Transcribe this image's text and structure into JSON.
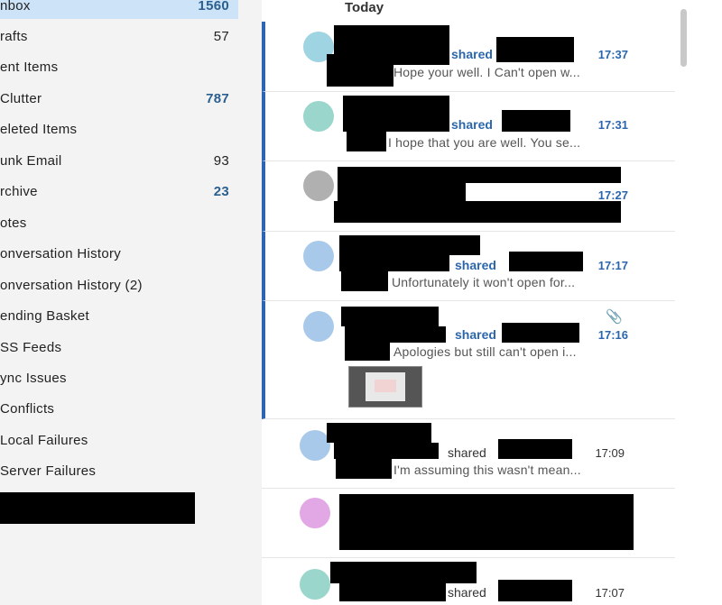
{
  "folders": [
    {
      "label": "nbox",
      "count": "1560",
      "unread": true,
      "selected": true
    },
    {
      "label": "rafts",
      "count": "57",
      "unread": false
    },
    {
      "label": "ent Items",
      "count": "",
      "unread": false
    },
    {
      "label": "Clutter",
      "count": "787",
      "unread": true
    },
    {
      "label": "eleted Items",
      "count": "",
      "unread": false
    },
    {
      "label": "unk Email",
      "count": "93",
      "unread": false
    },
    {
      "label": "rchive",
      "count": "23",
      "unread": true
    },
    {
      "label": "otes",
      "count": "",
      "unread": false
    },
    {
      "label": "onversation History",
      "count": "",
      "unread": false
    },
    {
      "label": "onversation History (2)",
      "count": "",
      "unread": false
    },
    {
      "label": "ending Basket",
      "count": "",
      "unread": false
    },
    {
      "label": "SS Feeds",
      "count": "",
      "unread": false
    },
    {
      "label": "ync Issues",
      "count": "",
      "unread": false
    },
    {
      "label": "Conflicts",
      "count": "",
      "unread": false
    },
    {
      "label": "Local Failures",
      "count": "",
      "unread": false
    },
    {
      "label": "Server Failures",
      "count": "",
      "unread": false
    }
  ],
  "list": {
    "header": "Today",
    "messages": [
      {
        "shared": "shared",
        "time": "17:37",
        "preview": "Hope your well. I Can't open w...",
        "unread": true
      },
      {
        "shared": "shared",
        "time": "17:31",
        "preview": "I hope that you are well. You se...",
        "unread": true
      },
      {
        "shared": "",
        "time": "17:27",
        "preview": "",
        "unread": true
      },
      {
        "shared": "shared",
        "time": "17:17",
        "preview": "Unfortunately it won't open for...",
        "unread": true
      },
      {
        "shared": "shared",
        "time": "17:16",
        "preview": "Apologies but still can't open i...",
        "unread": true,
        "attachment": true
      },
      {
        "shared": "shared",
        "time": "17:09",
        "preview": "I'm assuming this wasn't mean...",
        "unread": false
      },
      {
        "shared": "",
        "time": "",
        "preview": "",
        "unread": false
      },
      {
        "shared": "shared",
        "time": "17:07",
        "preview": "",
        "unread": false
      }
    ]
  },
  "icons": {
    "attachment": "paperclip-icon"
  },
  "colors": {
    "accent": "#2f63b4",
    "selected_folder": "#cde3f7",
    "unread_text": "#2b66ad"
  }
}
